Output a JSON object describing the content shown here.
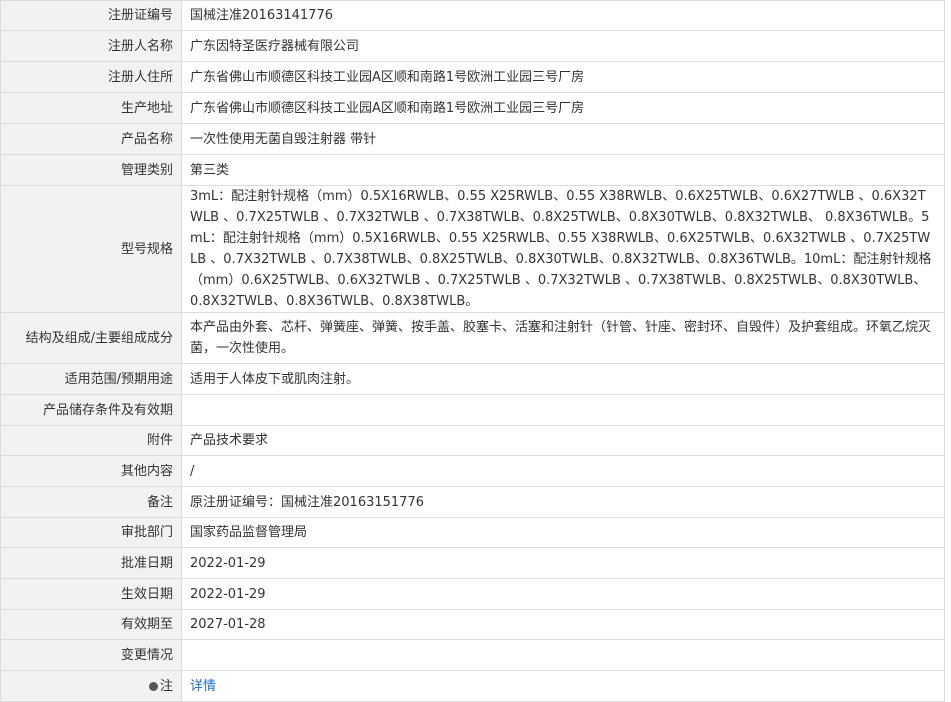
{
  "rows": [
    {
      "label": "注册证编号",
      "value": "国械注准20163141776"
    },
    {
      "label": "注册人名称",
      "value": "广东因特圣医疗器械有限公司"
    },
    {
      "label": "注册人住所",
      "value": "广东省佛山市顺德区科技工业园A区顺和南路1号欧洲工业园三号厂房"
    },
    {
      "label": "生产地址",
      "value": "广东省佛山市顺德区科技工业园A区顺和南路1号欧洲工业园三号厂房"
    },
    {
      "label": "产品名称",
      "value": "一次性使用无菌自毁注射器 带针"
    },
    {
      "label": "管理类别",
      "value": "第三类"
    },
    {
      "label": "型号规格",
      "value": "3mL：配注射针规格（mm）0.5X16RWLB、0.55 X25RWLB、0.55 X38RWLB、0.6X25TWLB、0.6X27TWLB 、0.6X32TWLB 、0.7X25TWLB 、0.7X32TWLB 、0.7X38TWLB、0.8X25TWLB、0.8X30TWLB、0.8X32TWLB、 0.8X36TWLB。5mL：配注射针规格（mm）0.5X16RWLB、0.55 X25RWLB、0.55 X38RWLB、0.6X25TWLB、0.6X32TWLB 、0.7X25TWLB 、0.7X32TWLB 、0.7X38TWLB、0.8X25TWLB、0.8X30TWLB、0.8X32TWLB、0.8X36TWLB。10mL：配注射针规格（mm）0.6X25TWLB、0.6X32TWLB 、0.7X25TWLB 、0.7X32TWLB 、0.7X38TWLB、0.8X25TWLB、0.8X30TWLB、0.8X32TWLB、0.8X36TWLB、0.8X38TWLB。"
    },
    {
      "label": "结构及组成/主要组成成分",
      "value": "本产品由外套、芯杆、弹簧座、弹簧、按手盖、胶塞卡、活塞和注射针（针管、针座、密封环、自毁件）及护套组成。环氧乙烷灭菌，一次性使用。"
    },
    {
      "label": "适用范围/预期用途",
      "value": "适用于人体皮下或肌肉注射。"
    },
    {
      "label": "产品储存条件及有效期",
      "value": ""
    },
    {
      "label": "附件",
      "value": "产品技术要求"
    },
    {
      "label": "其他内容",
      "value": "/"
    },
    {
      "label": "备注",
      "value": "原注册证编号：国械注准20163151776"
    },
    {
      "label": "审批部门",
      "value": "国家药品监督管理局"
    },
    {
      "label": "批准日期",
      "value": "2022-01-29"
    },
    {
      "label": "生效日期",
      "value": "2022-01-29"
    },
    {
      "label": "有效期至",
      "value": "2027-01-28"
    },
    {
      "label": "变更情况",
      "value": ""
    }
  ],
  "note_row": {
    "label": "注",
    "link_text": "详情"
  }
}
